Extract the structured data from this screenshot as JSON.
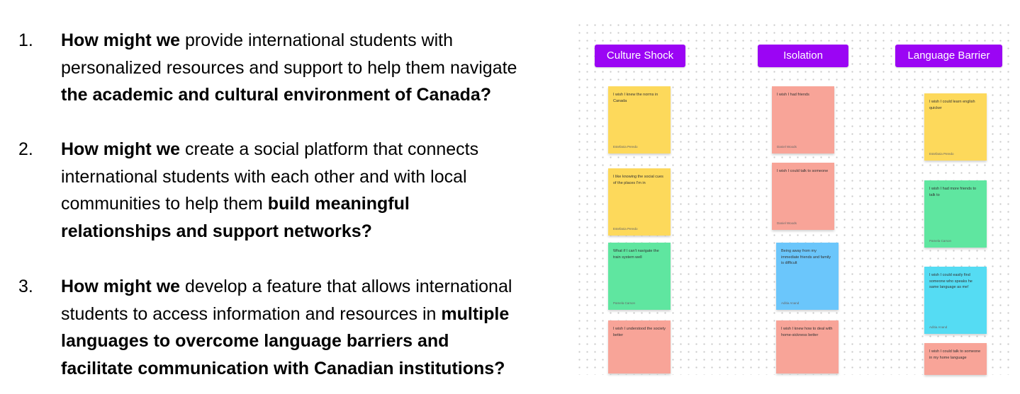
{
  "hmw_items": [
    {
      "number": "1.",
      "lines": [
        [
          {
            "text": "How might we",
            "bold": true
          },
          {
            "text": " provide international students with",
            "bold": false
          }
        ],
        [
          {
            "text": "personalized resources and support to help them navigate",
            "bold": false
          }
        ],
        [
          {
            "text": "the academic and cultural environment of Canada?",
            "bold": true
          }
        ]
      ]
    },
    {
      "number": "2.",
      "lines": [
        [
          {
            "text": "How might we",
            "bold": true
          },
          {
            "text": " create a social platform that connects",
            "bold": false
          }
        ],
        [
          {
            "text": "international students with each other and with local",
            "bold": false
          }
        ],
        [
          {
            "text": "communities to help them ",
            "bold": false
          },
          {
            "text": "build meaningful",
            "bold": true
          }
        ],
        [
          {
            "text": "relationships and support networks?",
            "bold": true
          }
        ]
      ]
    },
    {
      "number": "3.",
      "lines": [
        [
          {
            "text": "How might we",
            "bold": true
          },
          {
            "text": " develop a feature that allows international",
            "bold": false
          }
        ],
        [
          {
            "text": "students to access information and resources in ",
            "bold": false
          },
          {
            "text": "multiple",
            "bold": true
          }
        ],
        [
          {
            "text": "languages to overcome language barriers and",
            "bold": true
          }
        ],
        [
          {
            "text": "facilitate communication with Canadian institutions?",
            "bold": true
          }
        ]
      ]
    }
  ],
  "board": {
    "columns": [
      {
        "header": "Culture Shock",
        "notes": [
          {
            "text": "I wish I knew the norms in Canada",
            "author": "Estefania Peredo",
            "color": "yellow"
          },
          {
            "text": "I like knowing the social cues of the places I'm in",
            "author": "Estefania Peredo",
            "color": "yellow"
          },
          {
            "text": "What if I can't navigate the train system well",
            "author": "Pamela Carson",
            "color": "green"
          },
          {
            "text": "I wish I understood the society better",
            "author": "",
            "color": "salmon"
          }
        ]
      },
      {
        "header": "Isolation",
        "notes": [
          {
            "text": "I wish I had friends",
            "author": "Daniel Woods",
            "color": "salmon"
          },
          {
            "text": "I wish I could talk to someone",
            "author": "Daniel Woods",
            "color": "salmon"
          },
          {
            "text": "Being away from my immediate friends and family is difficult",
            "author": "Aditia Anand",
            "color": "blue"
          },
          {
            "text": "I wish I knew how to deal with home-sickness better",
            "author": "",
            "color": "salmon"
          }
        ]
      },
      {
        "header": "Language Barrier",
        "notes": [
          {
            "text": "I wish I could learn english quicker",
            "author": "Estefania Peredo",
            "color": "yellow"
          },
          {
            "text": "I wish I had more friends to talk to",
            "author": "Pamela Carson",
            "color": "green"
          },
          {
            "text": "I wish I could easily find someone who speaks he same language as me!",
            "author": "Aditia Anand",
            "color": "cyan"
          },
          {
            "text": "I wish I could talk to someone in my home language",
            "author": "",
            "color": "salmon"
          }
        ]
      }
    ]
  }
}
